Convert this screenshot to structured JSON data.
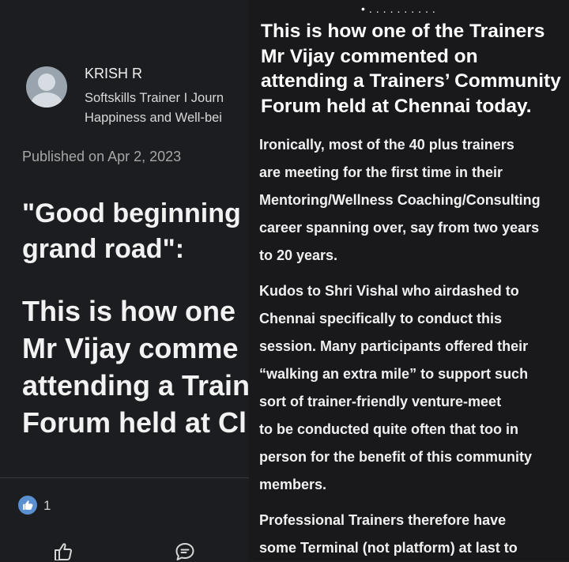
{
  "author": {
    "name": "KRISH R",
    "title_lines": [
      "Softskills Trainer I Journ",
      "Happiness and Well-bei"
    ]
  },
  "published": "Published on Apr 2, 2023",
  "headline_lines": [
    "\"Good beginning",
    "grand road\":"
  ],
  "lead_lines": [
    "This is how one",
    "Mr Vijay comme",
    "attending a Train",
    "Forum held at Cl"
  ],
  "reactions": {
    "count": "1"
  },
  "actions": {
    "like_icon": "thumbs-up-icon",
    "comment_icon": "comment-icon"
  },
  "carousel": {
    "indicator": "•.........."
  },
  "detail": {
    "title_lines": [
      "This is how one of the Trainers",
      "Mr Vijay commented on",
      "attending a Trainers’ Community",
      "Forum held at Chennai today."
    ],
    "paragraph1": [
      "Ironically, most of the 40 plus trainers",
      "are meeting for the first time in their",
      "Mentoring/Wellness Coaching/Consulting",
      "career spanning over,  say from two years",
      "to 20 years."
    ],
    "paragraph2": [
      "Kudos to Shri Vishal who airdashed to",
      "Chennai specifically to conduct this",
      "session. Many participants offered their",
      "“walking an extra mile” to support such",
      "sort of trainer-friendly  venture-meet",
      "to be conducted quite often that too in",
      "person for the benefit of this community",
      "members."
    ],
    "paragraph3": [
      "Professional Trainers  therefore have",
      "some Terminal (not platform) at last to"
    ]
  },
  "colors": {
    "background": "#1c1d21",
    "text": "#e8e8e8",
    "like_badge": "#5a8fd0"
  }
}
